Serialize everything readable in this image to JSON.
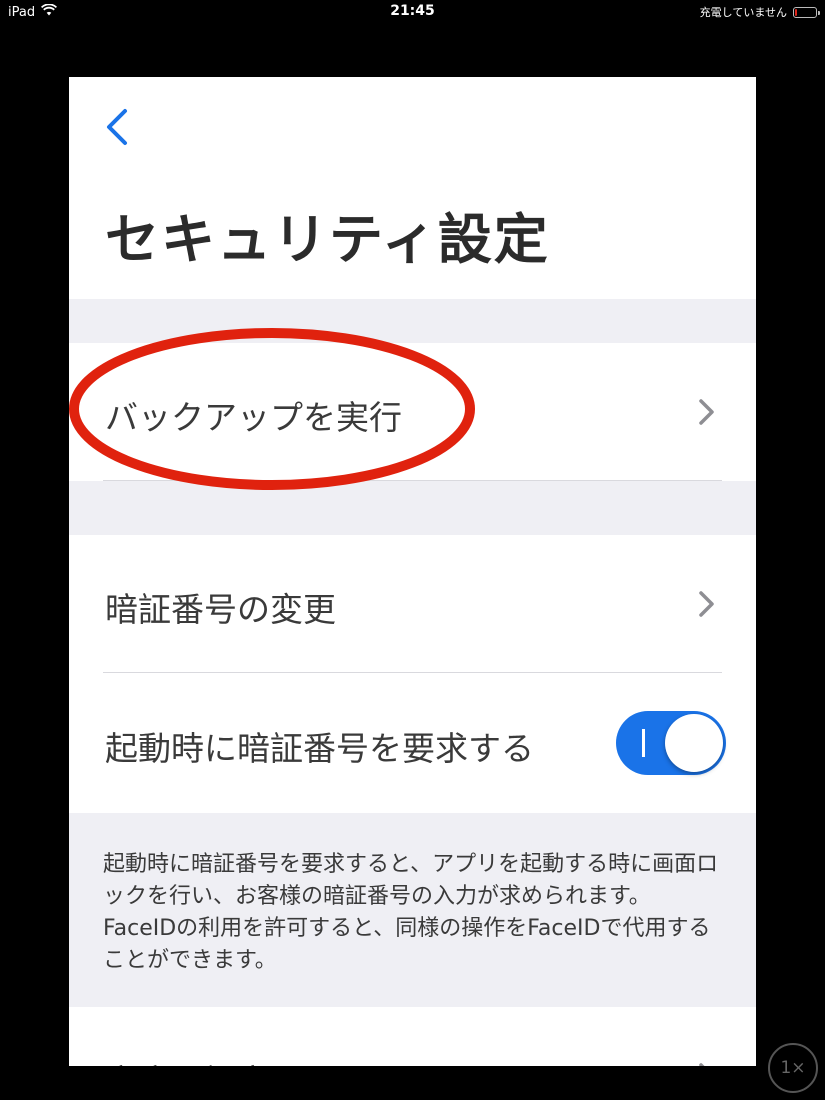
{
  "status_bar": {
    "device": "iPad",
    "time": "21:45",
    "charging": "充電していません",
    "battery_level": 0.1,
    "battery_color": "#e0261b"
  },
  "nav": {
    "back_icon": "chevron-left-icon",
    "accent": "#1a73e8"
  },
  "page": {
    "title": "セキュリティ設定"
  },
  "rows": [
    {
      "label": "バックアップを実行",
      "accessory": "chevron-right-icon"
    },
    {
      "label": "暗証番号の変更",
      "accessory": "chevron-right-icon"
    },
    {
      "label": "起動時に暗証番号を要求する",
      "accessory": "toggle",
      "toggle_on": true
    },
    {
      "label": "高度な設定",
      "accessory": "chevron-right-icon"
    }
  ],
  "footer_note": "起動時に暗証番号を要求すると、アプリを起動する時に画面ロックを行い、お客様の暗証番号の入力が求められます。FaceIDの利用を許可すると、同様の操作をFaceIDで代用することができます。",
  "annotation": {
    "shape": "ellipse",
    "color": "#e0220e",
    "target": "バックアップを実行"
  },
  "zoom": "1×",
  "colors": {
    "group_background": "#efeff4",
    "toggle_on": "#1a73e8"
  }
}
